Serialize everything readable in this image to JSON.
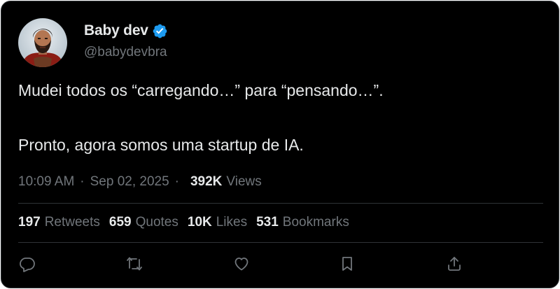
{
  "author": {
    "display_name": "Baby dev",
    "handle": "@babydevbra",
    "verified": true,
    "avatar_icon": "avatar-spartan-warrior-icon"
  },
  "tweet": {
    "text": "Mudei todos os “carregando…” para “pensando…”.\n\nPronto, agora somos uma startup de IA.",
    "time": "10:09 AM",
    "date": "Sep 02, 2025",
    "views_count": "392K",
    "views_label": "Views"
  },
  "stats": [
    {
      "count": "197",
      "label": "Retweets"
    },
    {
      "count": "659",
      "label": "Quotes"
    },
    {
      "count": "10K",
      "label": "Likes"
    },
    {
      "count": "531",
      "label": "Bookmarks"
    }
  ],
  "actions": [
    {
      "icon": "reply-icon"
    },
    {
      "icon": "retweet-icon"
    },
    {
      "icon": "like-heart-icon"
    },
    {
      "icon": "bookmark-icon"
    },
    {
      "icon": "share-icon"
    }
  ],
  "colors": {
    "background": "#000000",
    "primary_text": "#e7e9ea",
    "secondary_text": "#71767b",
    "border": "#2f3336",
    "verified_badge": "#1d9bf0"
  }
}
